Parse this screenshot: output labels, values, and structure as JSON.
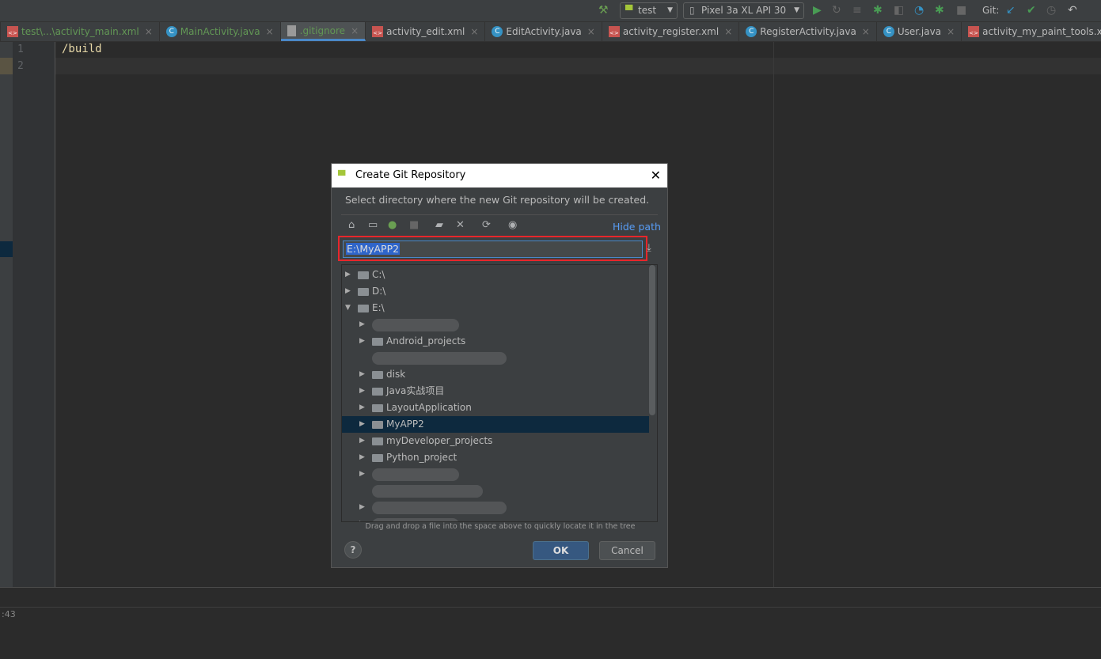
{
  "toolbar": {
    "run_config": "test",
    "device": "Pixel 3a XL API 30",
    "git_label": "Git:"
  },
  "tabs": [
    {
      "label": "test\\...\\activity_main.xml",
      "type": "xml",
      "green": true
    },
    {
      "label": "MainActivity.java",
      "type": "class",
      "green": true
    },
    {
      "label": ".gitignore",
      "type": "file",
      "green": true,
      "active": true
    },
    {
      "label": "activity_edit.xml",
      "type": "xml"
    },
    {
      "label": "EditActivity.java",
      "type": "class"
    },
    {
      "label": "activity_register.xml",
      "type": "xml"
    },
    {
      "label": "RegisterActivity.java",
      "type": "class"
    },
    {
      "label": "User.java",
      "type": "class"
    },
    {
      "label": "activity_my_paint_tools.xml",
      "type": "xml"
    }
  ],
  "editor": {
    "line_numbers": [
      "1",
      "2"
    ],
    "code": "/build"
  },
  "status": {
    "position": ":43"
  },
  "dialog": {
    "title": "Create Git Repository",
    "description": "Select directory where the new Git repository will be created.",
    "hide_path": "Hide path",
    "path_value": "E:\\MyAPP2",
    "hint": "Drag and drop a file into the space above to quickly locate it in the tree",
    "ok": "OK",
    "cancel": "Cancel",
    "help": "?",
    "tree": [
      {
        "label": "C:\\",
        "level": 0,
        "expanded": false
      },
      {
        "label": "D:\\",
        "level": 0,
        "expanded": false
      },
      {
        "label": "E:\\",
        "level": 0,
        "expanded": true
      },
      {
        "label": "",
        "level": 1,
        "blurred": true
      },
      {
        "label": "Android_projects",
        "level": 1
      },
      {
        "label": "",
        "level": 1,
        "blurred": true,
        "noarrow": true
      },
      {
        "label": "disk",
        "level": 1
      },
      {
        "label": "Java实战项目",
        "level": 1
      },
      {
        "label": "LayoutApplication",
        "level": 1
      },
      {
        "label": "MyAPP2",
        "level": 1,
        "selected": true
      },
      {
        "label": "myDeveloper_projects",
        "level": 1
      },
      {
        "label": "Python_project",
        "level": 1
      },
      {
        "label": "",
        "level": 1,
        "blurred": true
      },
      {
        "label": "",
        "level": 1,
        "blurred": true,
        "noarrow": true
      },
      {
        "label": "",
        "level": 1,
        "blurred": true
      },
      {
        "label": "",
        "level": 1,
        "blurred": true
      }
    ]
  },
  "colors": {
    "accent": "#4a88c7",
    "highlight_box": "#e8262b",
    "ok_button": "#365880",
    "selection": "#0d293e"
  }
}
